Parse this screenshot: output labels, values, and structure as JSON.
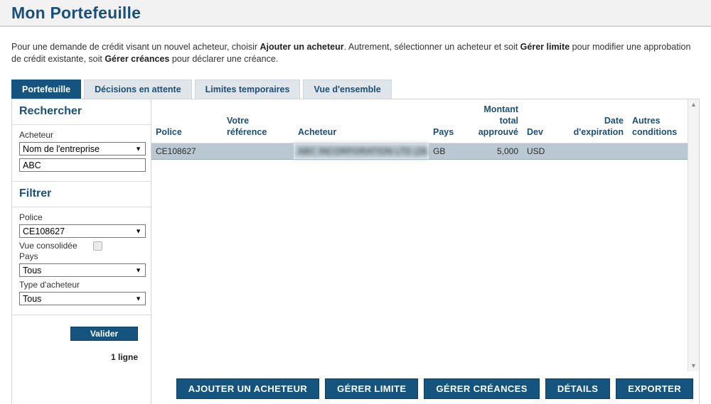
{
  "header": {
    "title": "Mon Portefeuille"
  },
  "intro": {
    "part1": "Pour une demande de crédit visant un nouvel acheteur, choisir ",
    "b1": "Ajouter un acheteur",
    "part2": ". Autrement, sélectionner un acheteur et soit ",
    "b2": "Gérer limite",
    "part3": " pour modifier une approbation de crédit existante, soit ",
    "b3": "Gérer créances",
    "part4": " pour déclarer une créance."
  },
  "tabs": [
    {
      "label": "Portefeuille",
      "active": true
    },
    {
      "label": "Décisions en attente",
      "active": false
    },
    {
      "label": "Limites temporaires",
      "active": false
    },
    {
      "label": "Vue d'ensemble",
      "active": false
    }
  ],
  "sidebar": {
    "search_title": "Rechercher",
    "filter_title": "Filtrer",
    "acheteur_label": "Acheteur",
    "acheteur_select_value": "Nom de l'entreprise",
    "acheteur_input_value": "ABC",
    "police_label": "Police",
    "police_select_value": "CE108627",
    "vue_consolidee_label": "Vue consolidée",
    "vue_consolidee_checked": false,
    "pays_label": "Pays",
    "pays_select_value": "Tous",
    "type_acheteur_label": "Type d'acheteur",
    "type_acheteur_select_value": "Tous",
    "validate_button": "Valider",
    "row_count": "1 ligne",
    "caret_glyph": "▼"
  },
  "table": {
    "columns": [
      {
        "label": "Police",
        "align": "left"
      },
      {
        "label": "Votre référence",
        "align": "left"
      },
      {
        "label": "Acheteur",
        "align": "left"
      },
      {
        "label": "Pays",
        "align": "left"
      },
      {
        "label": "Montant total approuvé",
        "align": "right"
      },
      {
        "label": "Dev",
        "align": "left"
      },
      {
        "label": "Date d'expiration",
        "align": "right"
      },
      {
        "label": "Autres conditions",
        "align": "left"
      }
    ],
    "rows": [
      {
        "police": "CE108627",
        "votre_reference": "",
        "acheteur": "ABC INCORPORATION LTD (26...",
        "pays": "GB",
        "montant_total_approuve": "5,000",
        "dev": "USD",
        "date_expiration": "",
        "autres_conditions": "",
        "selected": true
      }
    ],
    "scrollbar": {
      "up_glyph": "▲",
      "down_glyph": "▼"
    }
  },
  "actions": [
    {
      "label": "AJOUTER UN ACHETEUR"
    },
    {
      "label": "GÉRER LIMITE"
    },
    {
      "label": "GÉRER CRÉANCES"
    },
    {
      "label": "DÉTAILS"
    },
    {
      "label": "EXPORTER"
    }
  ],
  "colors": {
    "brand_navy": "#14547e",
    "title_blue": "#1a4f7a",
    "row_selected": "#b9c8d2",
    "tab_inactive": "#dfe5e9"
  }
}
